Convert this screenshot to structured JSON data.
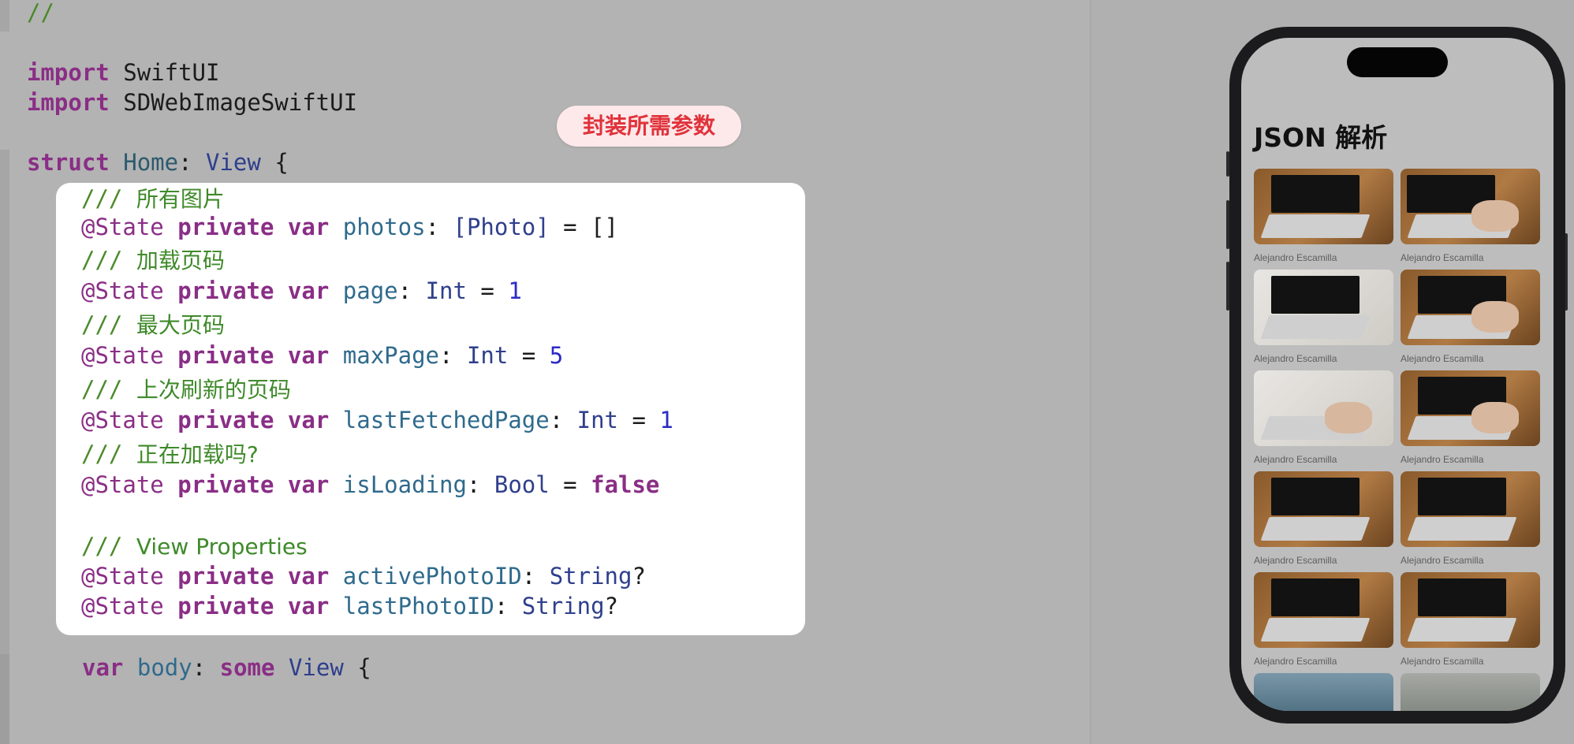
{
  "editor": {
    "lines": {
      "comment_top": "//",
      "import_kw_1": "import",
      "import_mod_1": "SwiftUI",
      "import_kw_2": "import",
      "import_mod_2": "SDWebImageSwiftUI",
      "struct_kw": "struct",
      "struct_name": "Home",
      "struct_colon": ":",
      "struct_type": "View",
      "struct_brace": " {",
      "c1_slash": "///",
      "c1_text": "所有图片",
      "l1": {
        "attr": "@State",
        "priv": "private",
        "var": "var",
        "name": "photos",
        "colon": ":",
        "type": "[Photo]",
        "rest": " = []"
      },
      "c2_slash": "///",
      "c2_text": "加载页码",
      "l2": {
        "attr": "@State",
        "priv": "private",
        "var": "var",
        "name": "page",
        "colon": ":",
        "type": "Int",
        "eq": " = ",
        "val": "1"
      },
      "c3_slash": "///",
      "c3_text": "最大页码",
      "l3": {
        "attr": "@State",
        "priv": "private",
        "var": "var",
        "name": "maxPage",
        "colon": ":",
        "type": "Int",
        "eq": " = ",
        "val": "5"
      },
      "c4_slash": "///",
      "c4_text": "上次刷新的页码",
      "l4": {
        "attr": "@State",
        "priv": "private",
        "var": "var",
        "name": "lastFetchedPage",
        "colon": ":",
        "type": "Int",
        "eq": " = ",
        "val": "1"
      },
      "c5_slash": "///",
      "c5_text": "正在加载吗?",
      "l5": {
        "attr": "@State",
        "priv": "private",
        "var": "var",
        "name": "isLoading",
        "colon": ":",
        "type": "Bool",
        "eq": " = ",
        "val": "false"
      },
      "c6_slash": "///",
      "c6_text": "View Properties",
      "l6": {
        "attr": "@State",
        "priv": "private",
        "var": "var",
        "name": "activePhotoID",
        "colon": ":",
        "type": "String",
        "rest": "?"
      },
      "l7": {
        "attr": "@State",
        "priv": "private",
        "var": "var",
        "name": "lastPhotoID",
        "colon": ":",
        "type": "String",
        "rest": "?"
      },
      "body": {
        "var": "var",
        "name": "body",
        "colon": ":",
        "some": "some",
        "type": "View",
        "brace": " {"
      }
    },
    "badge": "封装所需参数"
  },
  "preview": {
    "title": "JSON 解析",
    "photos": [
      {
        "author": "Alejandro Escamilla",
        "style": "wood-laptop"
      },
      {
        "author": "Alejandro Escamilla",
        "style": "wood-typing"
      },
      {
        "author": "Alejandro Escamilla",
        "style": "white-laptop"
      },
      {
        "author": "Alejandro Escamilla",
        "style": "phone-laptop"
      },
      {
        "author": "Alejandro Escamilla",
        "style": "hands-writing"
      },
      {
        "author": "Alejandro Escamilla",
        "style": "typing-laptop"
      },
      {
        "author": "Alejandro Escamilla",
        "style": "wood-laptop"
      },
      {
        "author": "Alejandro Escamilla",
        "style": "desk-notebook"
      },
      {
        "author": "Alejandro Escamilla",
        "style": "wood-laptop"
      },
      {
        "author": "Alejandro Escamilla",
        "style": "wood-laptop"
      },
      {
        "author": "",
        "style": "lake"
      },
      {
        "author": "",
        "style": "mist"
      }
    ]
  },
  "colors": {
    "editor_bg": "#b3b3b3",
    "highlight_bg": "#ffffff",
    "keyword": "#8a2e86",
    "comment": "#4a8a2a",
    "badge_text": "#e0323a",
    "badge_bg": "#fde8ea"
  }
}
